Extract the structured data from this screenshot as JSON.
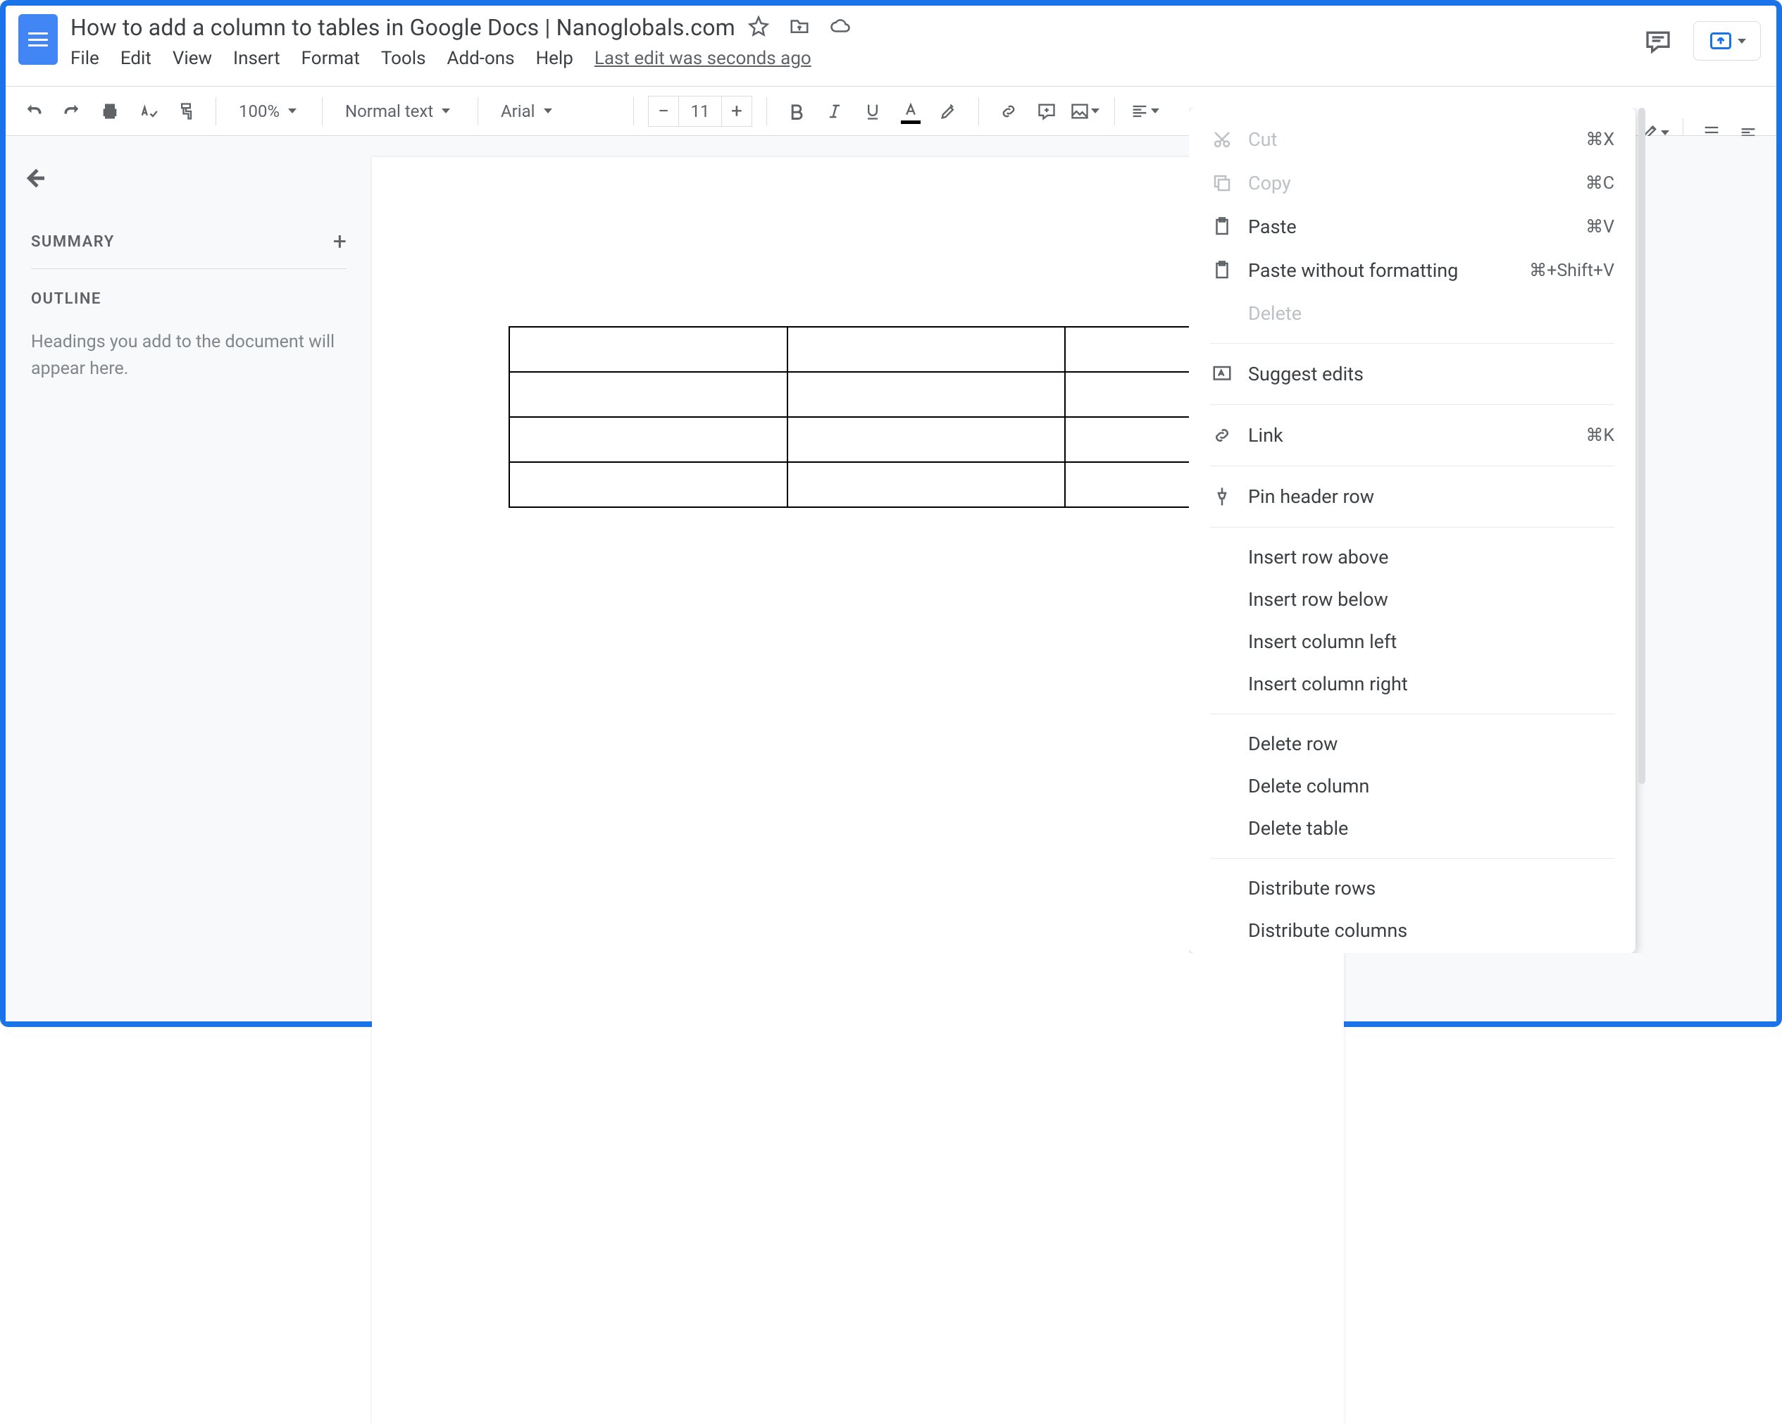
{
  "doc": {
    "title": "How to add a column to tables in Google Docs | Nanoglobals.com",
    "last_edit": "Last edit was seconds ago"
  },
  "menubar": [
    "File",
    "Edit",
    "View",
    "Insert",
    "Format",
    "Tools",
    "Add-ons",
    "Help"
  ],
  "toolbar": {
    "zoom": "100%",
    "style": "Normal text",
    "font": "Arial",
    "font_size": "11"
  },
  "sidebar": {
    "summary_label": "SUMMARY",
    "outline_label": "OUTLINE",
    "outline_placeholder": "Headings you add to the document will appear here."
  },
  "context_menu": {
    "items": [
      {
        "icon": "cut",
        "label": "Cut",
        "shortcut": "⌘X",
        "disabled": true
      },
      {
        "icon": "copy",
        "label": "Copy",
        "shortcut": "⌘C",
        "disabled": true
      },
      {
        "icon": "paste",
        "label": "Paste",
        "shortcut": "⌘V"
      },
      {
        "icon": "paste",
        "label": "Paste without formatting",
        "shortcut": "⌘+Shift+V"
      },
      {
        "noicon": true,
        "label": "Delete",
        "disabled": true
      },
      {
        "sep": true
      },
      {
        "icon": "suggest",
        "label": "Suggest edits"
      },
      {
        "sep": true
      },
      {
        "icon": "link",
        "label": "Link",
        "shortcut": "⌘K"
      },
      {
        "sep": true
      },
      {
        "icon": "pin",
        "label": "Pin header row"
      },
      {
        "sep": true
      },
      {
        "noicon": true,
        "label": "Insert row above"
      },
      {
        "noicon": true,
        "label": "Insert row below"
      },
      {
        "noicon": true,
        "label": "Insert column left"
      },
      {
        "noicon": true,
        "label": "Insert column right"
      },
      {
        "sep": true
      },
      {
        "noicon": true,
        "label": "Delete row"
      },
      {
        "noicon": true,
        "label": "Delete column"
      },
      {
        "noicon": true,
        "label": "Delete table"
      },
      {
        "sep": true
      },
      {
        "noicon": true,
        "label": "Distribute rows"
      },
      {
        "noicon": true,
        "label": "Distribute columns"
      }
    ]
  },
  "table": {
    "rows": 4,
    "cols": 3
  }
}
